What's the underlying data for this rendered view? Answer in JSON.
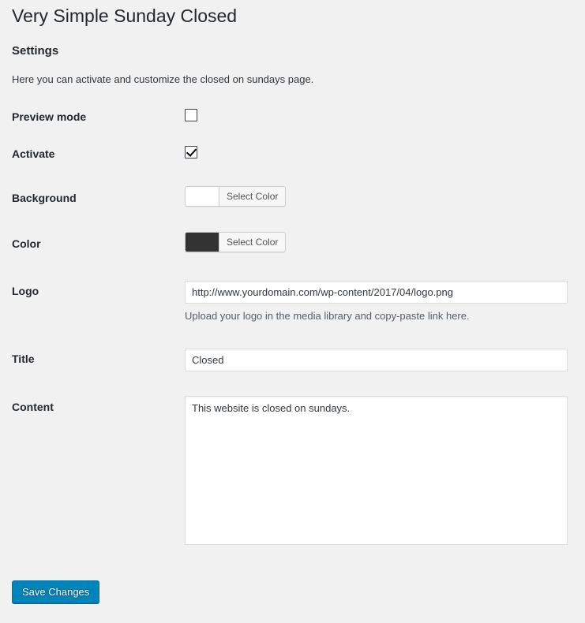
{
  "page": {
    "title": "Very Simple Sunday Closed",
    "section_heading": "Settings",
    "section_description": "Here you can activate and customize the closed on sundays page."
  },
  "fields": {
    "preview_mode": {
      "label": "Preview mode",
      "checked": false
    },
    "activate": {
      "label": "Activate",
      "checked": true
    },
    "background": {
      "label": "Background",
      "button_label": "Select Color",
      "swatch_color": "#ffffff"
    },
    "color": {
      "label": "Color",
      "button_label": "Select Color",
      "swatch_color": "#333333"
    },
    "logo": {
      "label": "Logo",
      "value": "http://www.yourdomain.com/wp-content/2017/04/logo.png",
      "description": "Upload your logo in the media library and copy-paste link here."
    },
    "title": {
      "label": "Title",
      "value": "Closed"
    },
    "content": {
      "label": "Content",
      "value": "This website is closed on sundays."
    }
  },
  "submit": {
    "label": "Save Changes",
    "accent_color": "#0085ba"
  },
  "theme": {
    "background": "#f1f1f1",
    "text": "#23282d",
    "muted_text": "#555d66",
    "border": "#dddddd"
  }
}
